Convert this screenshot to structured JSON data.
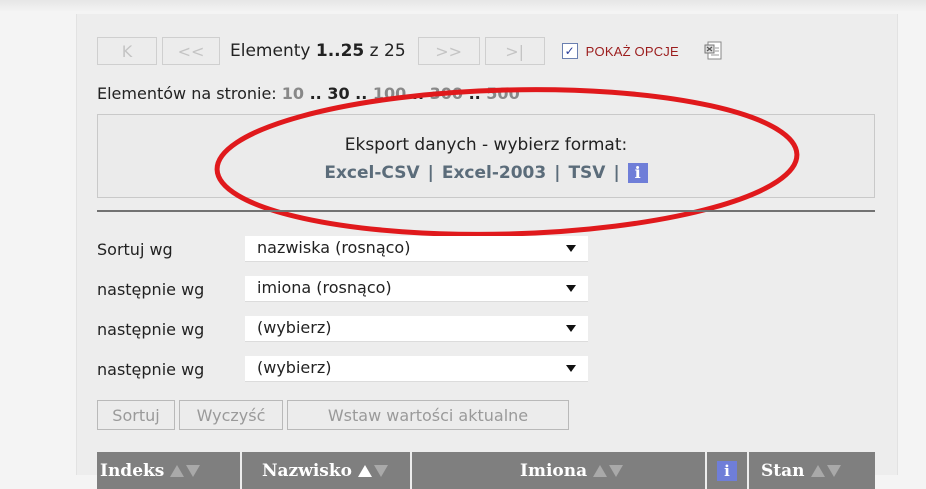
{
  "pager": {
    "first_label": "K",
    "prev_label": "<<",
    "range_prefix": "Elementy ",
    "range_value": "1..25",
    "range_suffix": " z 25",
    "next_label": ">>",
    "last_label": ">|",
    "show_options_checked": true,
    "show_options_label": "POKAŻ OPCJE"
  },
  "per_page": {
    "label": "Elementów na stronie: ",
    "options": [
      "10",
      "30",
      "100",
      "300",
      "500"
    ],
    "current": "30",
    "separator": " .. "
  },
  "export": {
    "title": "Eksport danych - wybierz format:",
    "formats": [
      "Excel-CSV",
      "Excel-2003",
      "TSV"
    ],
    "separator": "|",
    "info_icon": "i"
  },
  "sort": {
    "rows": [
      {
        "label": "Sortuj wg",
        "value": "nazwiska (rosnąco)"
      },
      {
        "label": "następnie wg",
        "value": "imiona (rosnąco)"
      },
      {
        "label": "następnie wg",
        "value": "(wybierz)"
      },
      {
        "label": "następnie wg",
        "value": "(wybierz)"
      }
    ],
    "buttons": [
      "Sortuj",
      "Wyczyść",
      "Wstaw wartości aktualne"
    ]
  },
  "table": {
    "columns": [
      "Indeks",
      "Nazwisko",
      "Imiona",
      "Stan"
    ],
    "info_icon": "i"
  },
  "colors": {
    "annotation_ellipse": "#e0191c",
    "link": "#5b6c7a",
    "header_bg": "#7f7f7f",
    "info_bg": "#6f7ed8",
    "options_label": "#9b1c1c"
  }
}
